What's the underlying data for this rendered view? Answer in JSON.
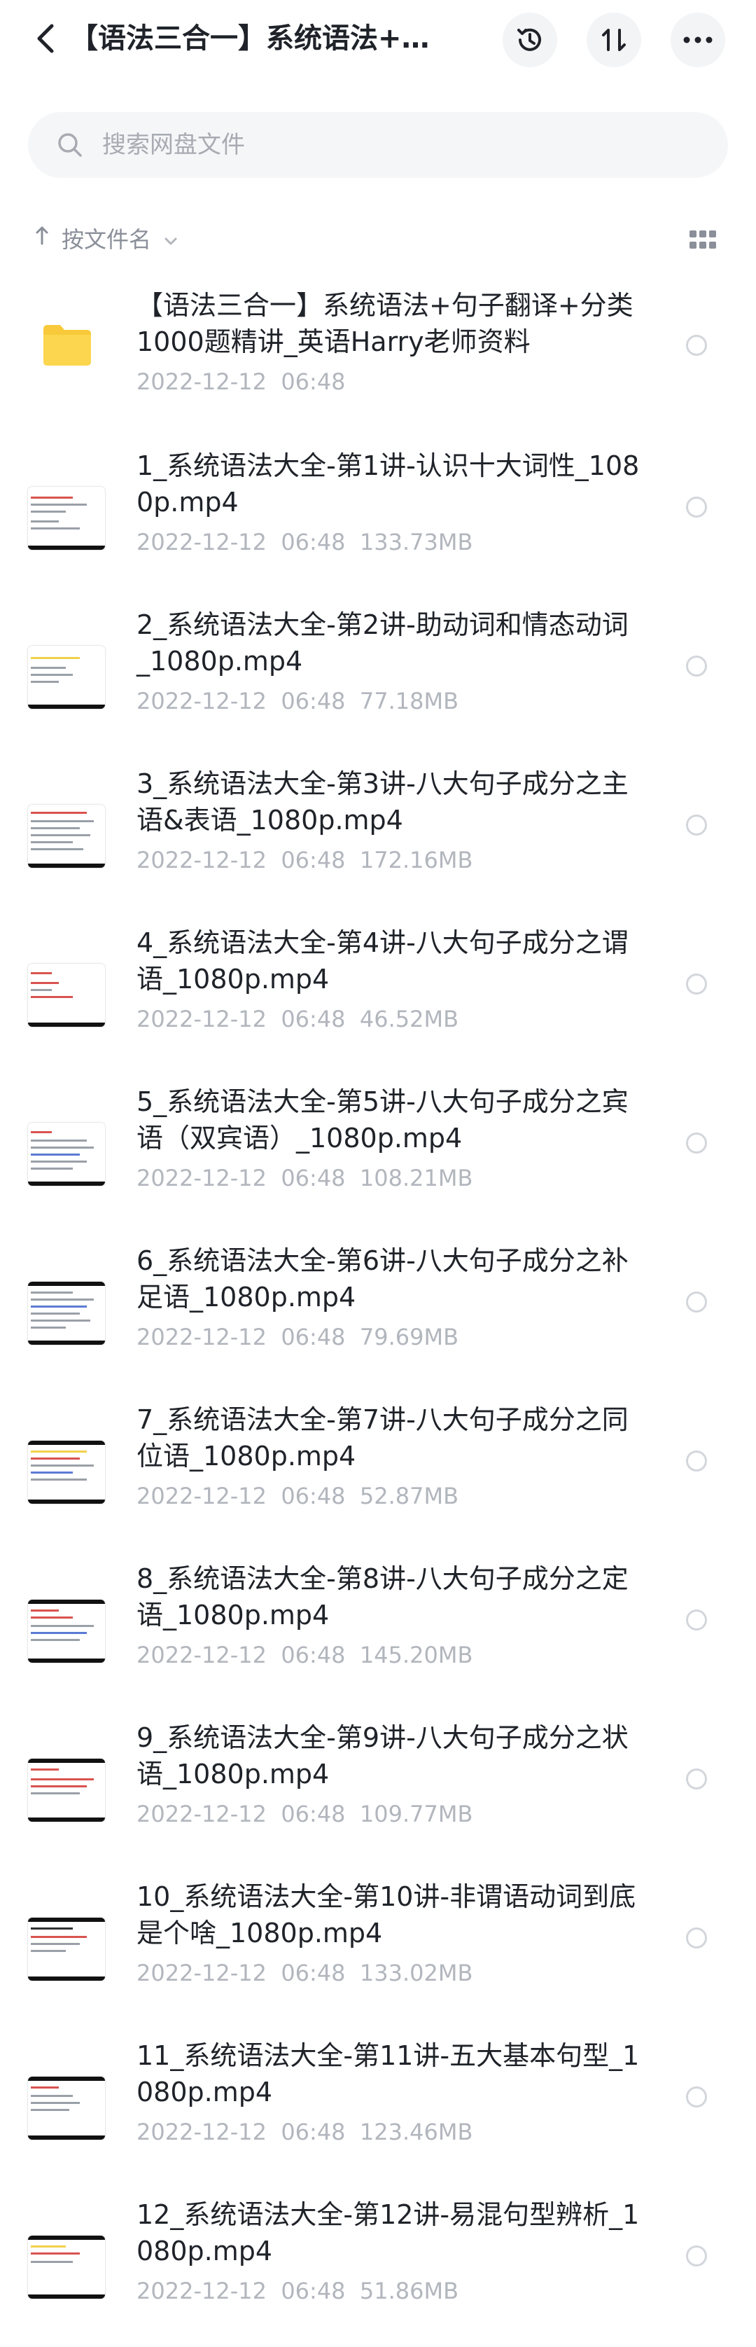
{
  "header": {
    "title": "【语法三合一】系统语法+句子翻译+分类1000题精讲_英语Harry老师资料",
    "icons": {
      "back": "back-arrow-icon",
      "history": "history-icon",
      "sort": "sort-icon",
      "more": "more-icon"
    }
  },
  "search": {
    "placeholder": "搜索网盘文件",
    "value": ""
  },
  "sortbar": {
    "label": "按文件名"
  },
  "files": [
    {
      "type": "folder",
      "name": "【语法三合一】系统语法+句子翻译+分类1000题精讲_英语Harry老师资料",
      "date": "2022-12-12",
      "time": "06:48",
      "size": ""
    },
    {
      "type": "video",
      "name": "1_系统语法大全-第1讲-认识十大词性_1080p.mp4",
      "date": "2022-12-12",
      "time": "06:48",
      "size": "133.73MB"
    },
    {
      "type": "video",
      "name": "2_系统语法大全-第2讲-助动词和情态动词_1080p.mp4",
      "date": "2022-12-12",
      "time": "06:48",
      "size": "77.18MB"
    },
    {
      "type": "video",
      "name": "3_系统语法大全-第3讲-八大句子成分之主语&表语_1080p.mp4",
      "date": "2022-12-12",
      "time": "06:48",
      "size": "172.16MB"
    },
    {
      "type": "video",
      "name": "4_系统语法大全-第4讲-八大句子成分之谓语_1080p.mp4",
      "date": "2022-12-12",
      "time": "06:48",
      "size": "46.52MB"
    },
    {
      "type": "video",
      "name": "5_系统语法大全-第5讲-八大句子成分之宾语（双宾语）_1080p.mp4",
      "date": "2022-12-12",
      "time": "06:48",
      "size": "108.21MB"
    },
    {
      "type": "video",
      "name": "6_系统语法大全-第6讲-八大句子成分之补足语_1080p.mp4",
      "date": "2022-12-12",
      "time": "06:48",
      "size": "79.69MB"
    },
    {
      "type": "video",
      "name": "7_系统语法大全-第7讲-八大句子成分之同位语_1080p.mp4",
      "date": "2022-12-12",
      "time": "06:48",
      "size": "52.87MB"
    },
    {
      "type": "video",
      "name": "8_系统语法大全-第8讲-八大句子成分之定语_1080p.mp4",
      "date": "2022-12-12",
      "time": "06:48",
      "size": "145.20MB"
    },
    {
      "type": "video",
      "name": "9_系统语法大全-第9讲-八大句子成分之状语_1080p.mp4",
      "date": "2022-12-12",
      "time": "06:48",
      "size": "109.77MB"
    },
    {
      "type": "video",
      "name": "10_系统语法大全-第10讲-非谓语动词到底是个啥_1080p.mp4",
      "date": "2022-12-12",
      "time": "06:48",
      "size": "133.02MB"
    },
    {
      "type": "video",
      "name": "11_系统语法大全-第11讲-五大基本句型_1080p.mp4",
      "date": "2022-12-12",
      "time": "06:48",
      "size": "123.46MB"
    },
    {
      "type": "video",
      "name": "12_系统语法大全-第12讲-易混句型辨析_1080p.mp4",
      "date": "2022-12-12",
      "time": "06:48",
      "size": "51.86MB"
    }
  ]
}
